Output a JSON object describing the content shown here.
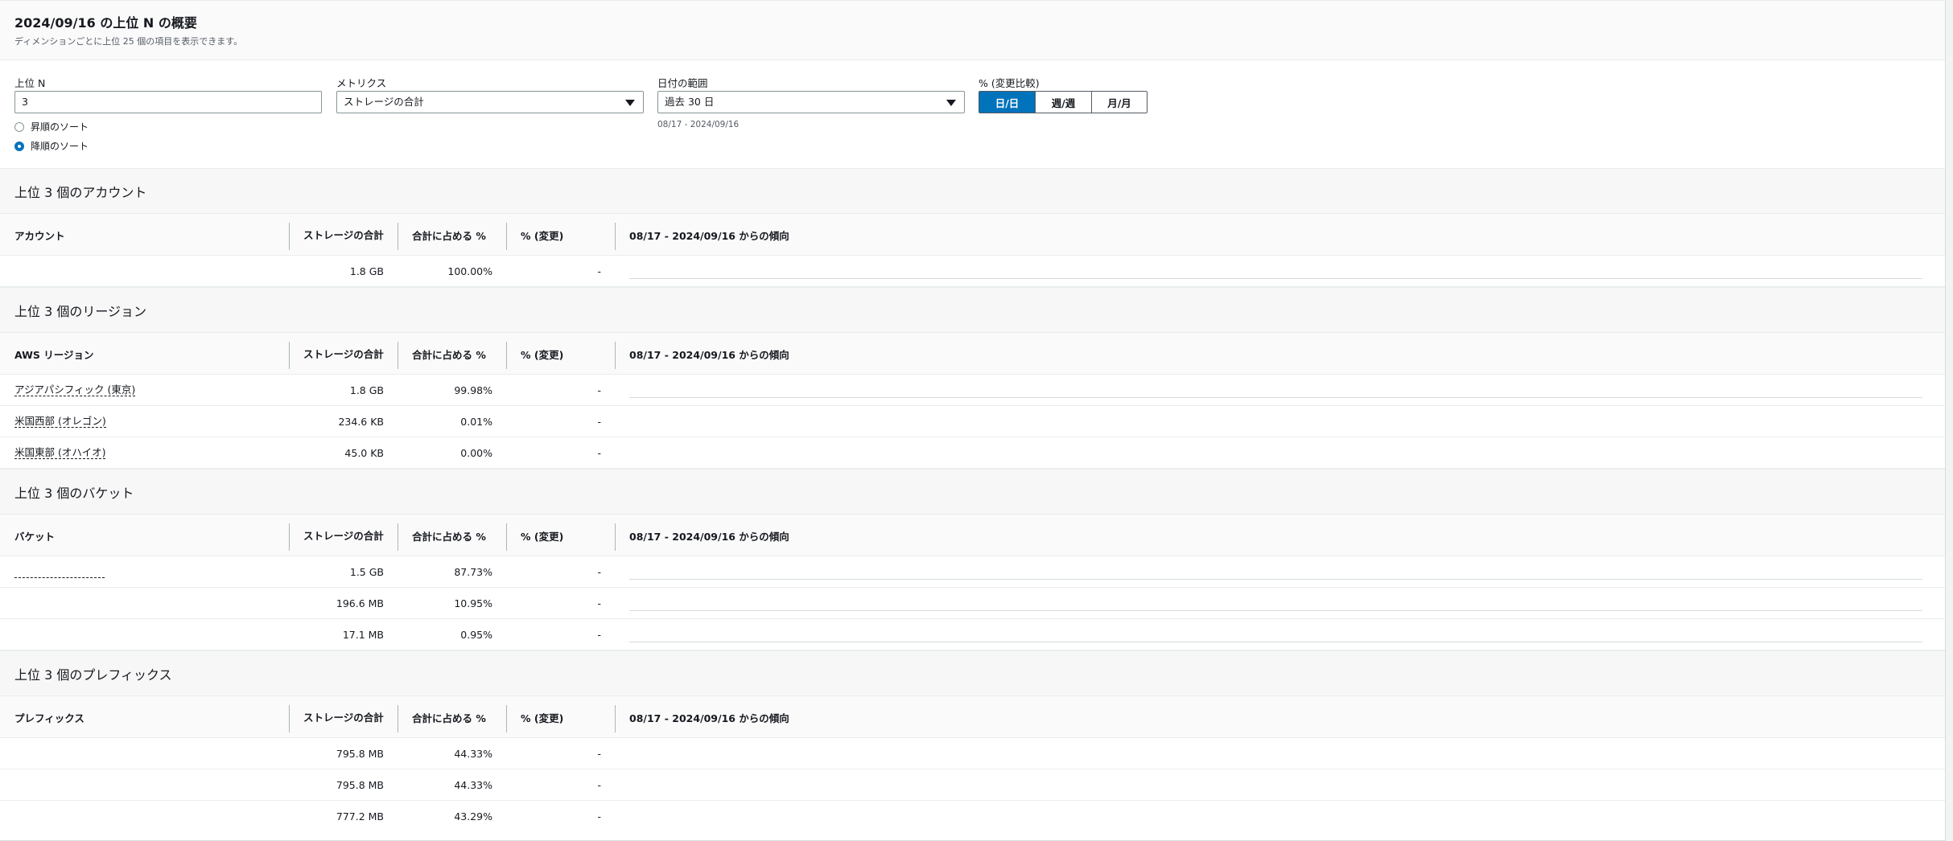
{
  "header": {
    "title": "2024/09/16 の上位 N の概要",
    "description": "ディメンションごとに上位 25 個の項目を表示できます。"
  },
  "controls": {
    "top_n": {
      "label": "上位 N",
      "value": "3"
    },
    "sort_asc": {
      "label": "昇順のソート",
      "checked": false
    },
    "sort_desc": {
      "label": "降順のソート",
      "checked": true
    },
    "metric": {
      "label": "メトリクス",
      "value": "ストレージの合計"
    },
    "date_range": {
      "label": "日付の範囲",
      "value": "過去 30 日",
      "hint": "08/17 - 2024/09/16"
    },
    "compare": {
      "label": "% (変更比較)",
      "options": [
        "日/日",
        "週/週",
        "月/月"
      ],
      "selected": "日/日"
    }
  },
  "common_columns": {
    "storage": "ストレージの合計",
    "percent_total": "合計に占める %",
    "percent_change": "% (変更)",
    "trend": "08/17 - 2024/09/16 からの傾向"
  },
  "sections": {
    "accounts": {
      "title": "上位 3 個のアカウント",
      "col_name": "アカウント",
      "rows": [
        {
          "name": "",
          "storage": "1.8 GB",
          "percent": "100.00%",
          "change": "-"
        }
      ]
    },
    "regions": {
      "title": "上位 3 個のリージョン",
      "col_name": "AWS リージョン",
      "rows": [
        {
          "name": "アジアパシフィック (東京)",
          "storage": "1.8 GB",
          "percent": "99.98%",
          "change": "-"
        },
        {
          "name": "米国西部 (オレゴン)",
          "storage": "234.6 KB",
          "percent": "0.01%",
          "change": "-"
        },
        {
          "name": "米国東部 (オハイオ)",
          "storage": "45.0 KB",
          "percent": "0.00%",
          "change": "-"
        }
      ]
    },
    "buckets": {
      "title": "上位 3 個のバケット",
      "col_name": "バケット",
      "rows": [
        {
          "name": "",
          "storage": "1.5 GB",
          "percent": "87.73%",
          "change": "-"
        },
        {
          "name": "",
          "storage": "196.6 MB",
          "percent": "10.95%",
          "change": "-"
        },
        {
          "name": "",
          "storage": "17.1 MB",
          "percent": "0.95%",
          "change": "-"
        }
      ]
    },
    "prefixes": {
      "title": "上位 3 個のプレフィックス",
      "col_name": "プレフィックス",
      "rows": [
        {
          "name": "",
          "storage": "795.8 MB",
          "percent": "44.33%",
          "change": "-"
        },
        {
          "name": "",
          "storage": "795.8 MB",
          "percent": "44.33%",
          "change": "-"
        },
        {
          "name": "",
          "storage": "777.2 MB",
          "percent": "43.29%",
          "change": "-"
        }
      ]
    }
  }
}
